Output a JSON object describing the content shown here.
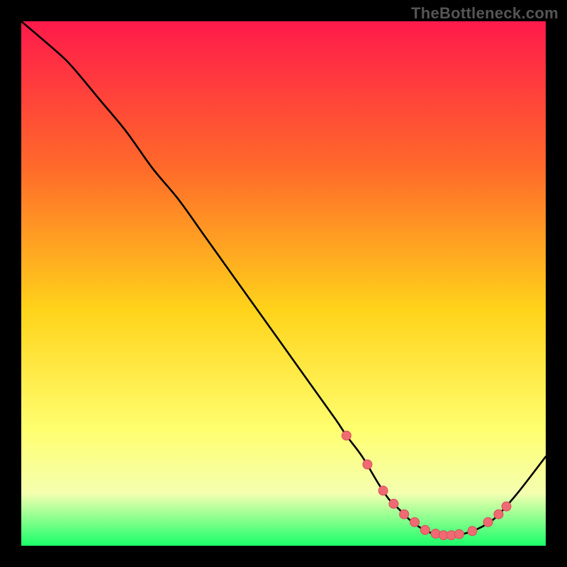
{
  "watermark": "TheBottleneck.com",
  "colors": {
    "page_bg": "#000000",
    "grad_top": "#ff1a4b",
    "grad_mid_upper": "#ff6a2a",
    "grad_mid": "#ffd31a",
    "grad_mid_lower": "#ffff70",
    "grad_lower": "#f4ffb0",
    "grad_bottom": "#1aff6a",
    "curve": "#000000",
    "marker_fill": "#ef6a72",
    "marker_stroke": "#d94f5a"
  },
  "chart_data": {
    "type": "line",
    "title": "",
    "xlabel": "",
    "ylabel": "",
    "xlim": [
      0,
      100
    ],
    "ylim": [
      0,
      100
    ],
    "series": [
      {
        "name": "bottleneck-curve",
        "x": [
          0,
          7,
          10,
          15,
          20,
          25,
          30,
          35,
          40,
          45,
          50,
          55,
          60,
          62,
          65,
          68,
          70,
          72,
          74,
          76,
          78,
          80,
          82,
          84,
          86,
          88,
          90,
          92,
          95,
          100
        ],
        "y": [
          100,
          94,
          91,
          85,
          79,
          72,
          66,
          59,
          52,
          45,
          38,
          31,
          24,
          21,
          17,
          12,
          9,
          7,
          5,
          3.5,
          2.5,
          2,
          2,
          2.2,
          2.8,
          3.7,
          5,
          7,
          10.5,
          17
        ]
      }
    ],
    "markers": {
      "name": "highlighted-points",
      "x": [
        62,
        66,
        69,
        71,
        73,
        75,
        77,
        79,
        80.5,
        82,
        83.5,
        86,
        89,
        91,
        92.5
      ],
      "y": [
        21,
        15.5,
        10.5,
        8,
        6,
        4.5,
        3,
        2.3,
        2,
        2,
        2.2,
        2.8,
        4.5,
        6,
        7.5
      ]
    }
  }
}
